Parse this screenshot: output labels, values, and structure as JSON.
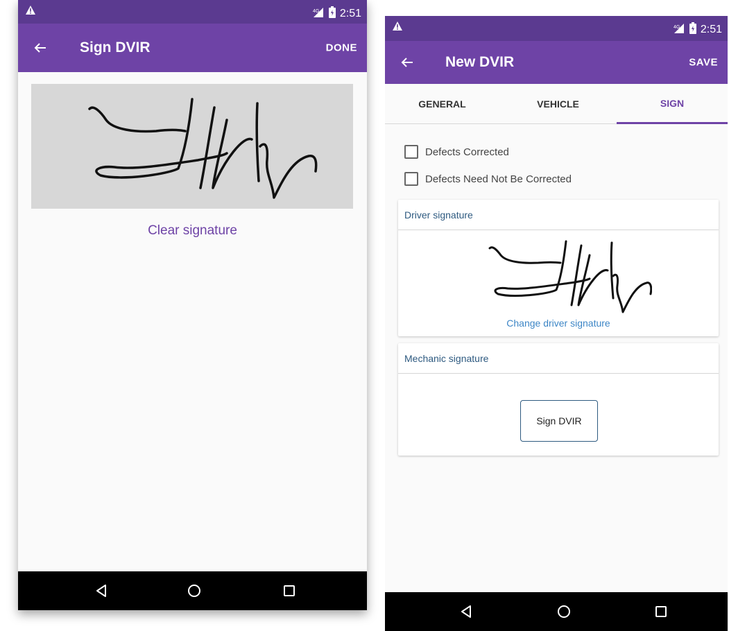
{
  "left_screen": {
    "status_time": "2:51",
    "title": "Sign DVIR",
    "action": "DONE",
    "clear_signature": "Clear signature"
  },
  "right_screen": {
    "status_time": "2:51",
    "title": "New DVIR",
    "action": "SAVE",
    "tabs": [
      {
        "label": "GENERAL",
        "active": false
      },
      {
        "label": "VEHICLE",
        "active": false
      },
      {
        "label": "SIGN",
        "active": true
      }
    ],
    "checkboxes": [
      {
        "label": "Defects Corrected",
        "checked": false
      },
      {
        "label": "Defects Need Not Be Corrected",
        "checked": false
      }
    ],
    "driver_card": {
      "header": "Driver signature",
      "change_label": "Change driver signature"
    },
    "mechanic_card": {
      "header": "Mechanic signature",
      "button_label": "Sign DVIR"
    }
  },
  "colors": {
    "status_bar": "#5b3a90",
    "app_bar": "#6e43a6",
    "accent": "#6e43a6",
    "link": "#3d86c6",
    "card_header_text": "#2e5a80"
  },
  "icons": [
    "warning-icon",
    "signal-icon",
    "battery-icon",
    "back-arrow-icon",
    "nav-back-icon",
    "nav-home-icon",
    "nav-recents-icon"
  ]
}
